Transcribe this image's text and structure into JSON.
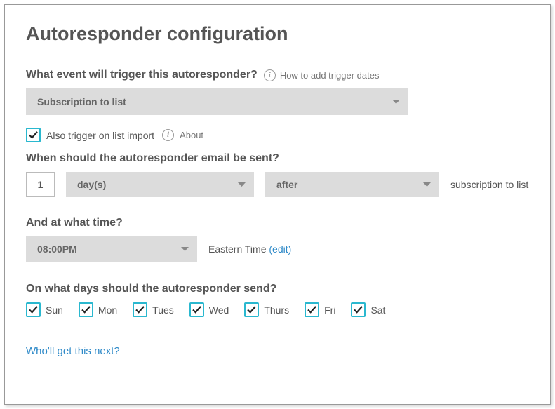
{
  "title": "Autoresponder configuration",
  "trigger": {
    "label": "What event will trigger this autoresponder?",
    "help": "How to add trigger dates",
    "selected": "Subscription to list"
  },
  "alsoTrigger": {
    "label": "Also trigger on list import",
    "about": "About"
  },
  "timing": {
    "label": "When should the autoresponder email be sent?",
    "count": "1",
    "unit": "day(s)",
    "relation": "after",
    "suffix": "subscription to list"
  },
  "time": {
    "label": "And at what time?",
    "selected": "08:00PM",
    "tz": "Eastern Time",
    "edit": "(edit)"
  },
  "days": {
    "label": "On what days should the autoresponder send?",
    "items": [
      "Sun",
      "Mon",
      "Tues",
      "Wed",
      "Thurs",
      "Fri",
      "Sat"
    ]
  },
  "footerLink": "Who'll get this next?"
}
